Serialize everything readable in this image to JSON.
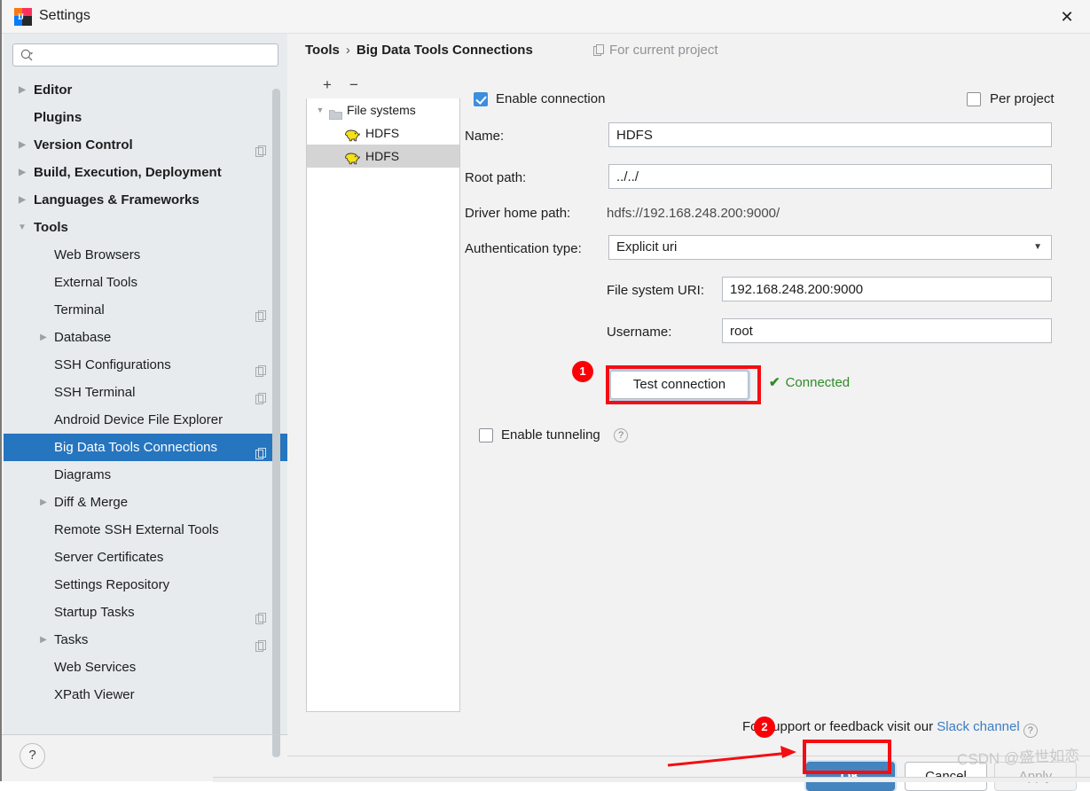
{
  "window": {
    "title": "Settings",
    "close_label": "✕",
    "app_icon": "intellij-idea-icon"
  },
  "sidebar": {
    "search": {
      "value": "",
      "placeholder": "",
      "icon": "search-icon"
    },
    "items": [
      {
        "label": "Editor",
        "level": 0,
        "arrow": "collapsed",
        "bold": true,
        "copy": false,
        "selected": false
      },
      {
        "label": "Plugins",
        "level": 0,
        "arrow": "none",
        "bold": true,
        "copy": false,
        "selected": false
      },
      {
        "label": "Version Control",
        "level": 0,
        "arrow": "collapsed",
        "bold": true,
        "copy": true,
        "selected": false
      },
      {
        "label": "Build, Execution, Deployment",
        "level": 0,
        "arrow": "collapsed",
        "bold": true,
        "copy": false,
        "selected": false
      },
      {
        "label": "Languages & Frameworks",
        "level": 0,
        "arrow": "collapsed",
        "bold": true,
        "copy": false,
        "selected": false
      },
      {
        "label": "Tools",
        "level": 0,
        "arrow": "expanded",
        "bold": true,
        "copy": false,
        "selected": false
      },
      {
        "label": "Web Browsers",
        "level": 1,
        "arrow": "none",
        "bold": false,
        "copy": false,
        "selected": false
      },
      {
        "label": "External Tools",
        "level": 1,
        "arrow": "none",
        "bold": false,
        "copy": false,
        "selected": false
      },
      {
        "label": "Terminal",
        "level": 1,
        "arrow": "none",
        "bold": false,
        "copy": true,
        "selected": false
      },
      {
        "label": "Database",
        "level": 1,
        "arrow": "collapsed",
        "bold": false,
        "copy": false,
        "selected": false
      },
      {
        "label": "SSH Configurations",
        "level": 1,
        "arrow": "none",
        "bold": false,
        "copy": true,
        "selected": false
      },
      {
        "label": "SSH Terminal",
        "level": 1,
        "arrow": "none",
        "bold": false,
        "copy": true,
        "selected": false
      },
      {
        "label": "Android Device File Explorer",
        "level": 1,
        "arrow": "none",
        "bold": false,
        "copy": false,
        "selected": false
      },
      {
        "label": "Big Data Tools Connections",
        "level": 1,
        "arrow": "none",
        "bold": false,
        "copy": true,
        "selected": true
      },
      {
        "label": "Diagrams",
        "level": 1,
        "arrow": "none",
        "bold": false,
        "copy": false,
        "selected": false
      },
      {
        "label": "Diff & Merge",
        "level": 1,
        "arrow": "collapsed",
        "bold": false,
        "copy": false,
        "selected": false
      },
      {
        "label": "Remote SSH External Tools",
        "level": 1,
        "arrow": "none",
        "bold": false,
        "copy": false,
        "selected": false
      },
      {
        "label": "Server Certificates",
        "level": 1,
        "arrow": "none",
        "bold": false,
        "copy": false,
        "selected": false
      },
      {
        "label": "Settings Repository",
        "level": 1,
        "arrow": "none",
        "bold": false,
        "copy": false,
        "selected": false
      },
      {
        "label": "Startup Tasks",
        "level": 1,
        "arrow": "none",
        "bold": false,
        "copy": true,
        "selected": false
      },
      {
        "label": "Tasks",
        "level": 1,
        "arrow": "collapsed",
        "bold": false,
        "copy": true,
        "selected": false
      },
      {
        "label": "Web Services",
        "level": 1,
        "arrow": "none",
        "bold": false,
        "copy": false,
        "selected": false
      },
      {
        "label": "XPath Viewer",
        "level": 1,
        "arrow": "none",
        "bold": false,
        "copy": false,
        "selected": false
      }
    ],
    "help_label": "?"
  },
  "header": {
    "breadcrumb_root": "Tools",
    "breadcrumb_sep": "›",
    "breadcrumb_current": "Big Data Tools Connections",
    "scope_label": "For current project"
  },
  "connections": {
    "toolbar": {
      "add_label": "+",
      "remove_label": "−"
    },
    "rows": [
      {
        "label": "File systems",
        "type": "folder",
        "indent": 0,
        "expanded": true,
        "selected": false
      },
      {
        "label": "HDFS",
        "type": "hadoop",
        "indent": 1,
        "expanded": false,
        "selected": false
      },
      {
        "label": "HDFS",
        "type": "hadoop",
        "indent": 1,
        "expanded": false,
        "selected": true
      }
    ]
  },
  "form": {
    "enable_connection_label": "Enable connection",
    "enable_connection_checked": true,
    "per_project_label": "Per project",
    "per_project_checked": false,
    "name_label": "Name:",
    "name_value": "HDFS",
    "root_path_label": "Root path:",
    "root_path_value": "../../",
    "driver_home_label": "Driver home path:",
    "driver_home_value": "hdfs://192.168.248.200:9000/",
    "auth_type_label": "Authentication type:",
    "auth_type_value": "Explicit uri",
    "fs_uri_label": "File system URI:",
    "fs_uri_value": "192.168.248.200:9000",
    "username_label": "Username:",
    "username_value": "root",
    "test_connection_label": "Test connection",
    "connected_label": "Connected",
    "connected_tick": "✔",
    "enable_tunneling_label": "Enable tunneling",
    "enable_tunneling_checked": false,
    "tunneling_help": "?"
  },
  "footer": {
    "support_text": "For support or feedback visit our",
    "support_link": "Slack channel",
    "support_help": "?",
    "ok_label": "OK",
    "cancel_label": "Cancel",
    "apply_label": "Apply"
  },
  "annotations": {
    "badge_one": "1",
    "badge_two": "2",
    "watermark": "CSDN @盛世如恋",
    "marker_color": "#fb0007"
  }
}
